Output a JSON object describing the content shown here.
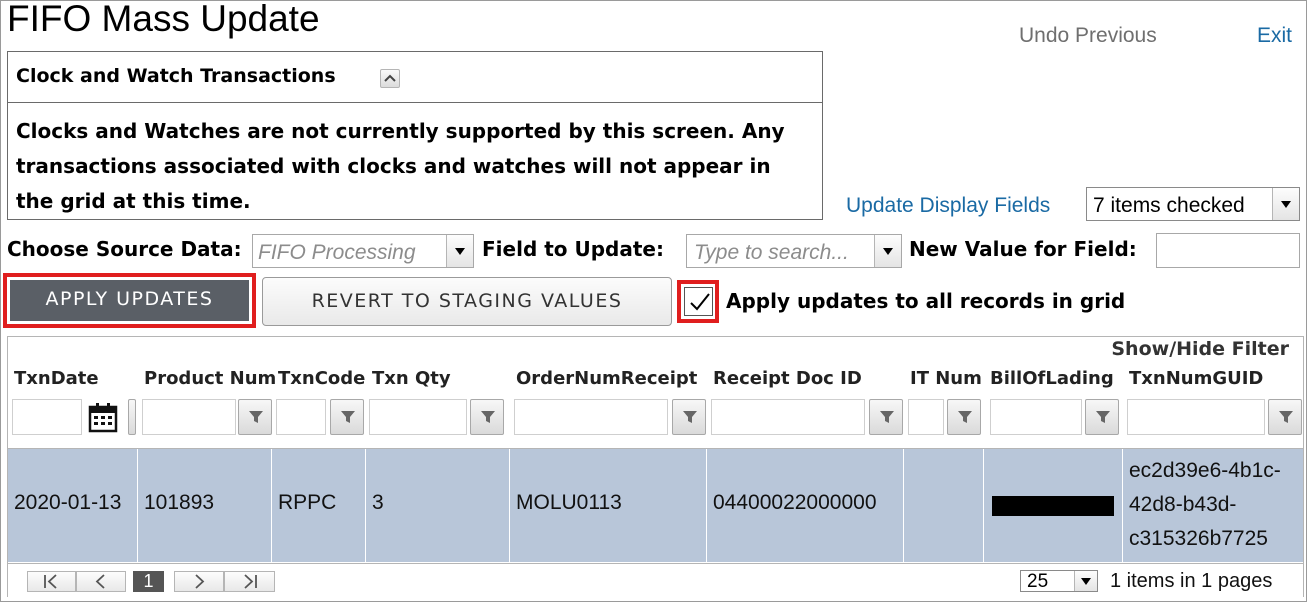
{
  "page": {
    "title": "FIFO Mass Update",
    "undo_label": "Undo Previous",
    "exit_label": "Exit"
  },
  "notice": {
    "title": "Clock and Watch Transactions",
    "lines": [
      "Clocks and Watches are not currently supported by this screen. Any",
      "transactions associated with clocks and watches will not appear in",
      "the grid at this time."
    ]
  },
  "display_fields": {
    "link_label": "Update Display Fields",
    "selected": "7 items checked"
  },
  "controls": {
    "source_label": "Choose Source Data:",
    "source_value": "FIFO Processing",
    "field_label": "Field to Update:",
    "field_placeholder": "Type to search...",
    "new_value_label": "New Value for Field:",
    "new_value": ""
  },
  "actions": {
    "apply_label": "APPLY UPDATES",
    "revert_label": "REVERT TO STAGING VALUES",
    "apply_all_label": "Apply updates to all records in grid",
    "apply_all_checked": true
  },
  "grid": {
    "show_hide_filter": "Show/Hide Filter",
    "columns": [
      "TxnDate",
      "Product Num",
      "TxnCode",
      "Txn Qty",
      "OrderNumReceipt",
      "Receipt Doc ID",
      "IT Num",
      "BillOfLading",
      "TxnNumGUID"
    ],
    "rows": [
      {
        "TxnDate": "2020-01-13",
        "ProductNum": "101893",
        "TxnCode": "RPPC",
        "TxnQty": "3",
        "OrderNumReceipt": "MOLU0113",
        "ReceiptDocID": "04400022000000",
        "ITNum": "",
        "BillOfLading": "[redacted]",
        "TxnNumGUID": [
          "ec2d39e6-4b1c-",
          "42d8-b43d-",
          "c315326b7725"
        ]
      }
    ],
    "pager": {
      "current_page": "1",
      "page_size": "25",
      "info": "1 items in 1 pages"
    }
  },
  "colors": {
    "link": "#1a6aa4",
    "selected_row": "#b8c6d9",
    "highlight": "#e01e1e",
    "primary_button": "#5a5f66"
  }
}
